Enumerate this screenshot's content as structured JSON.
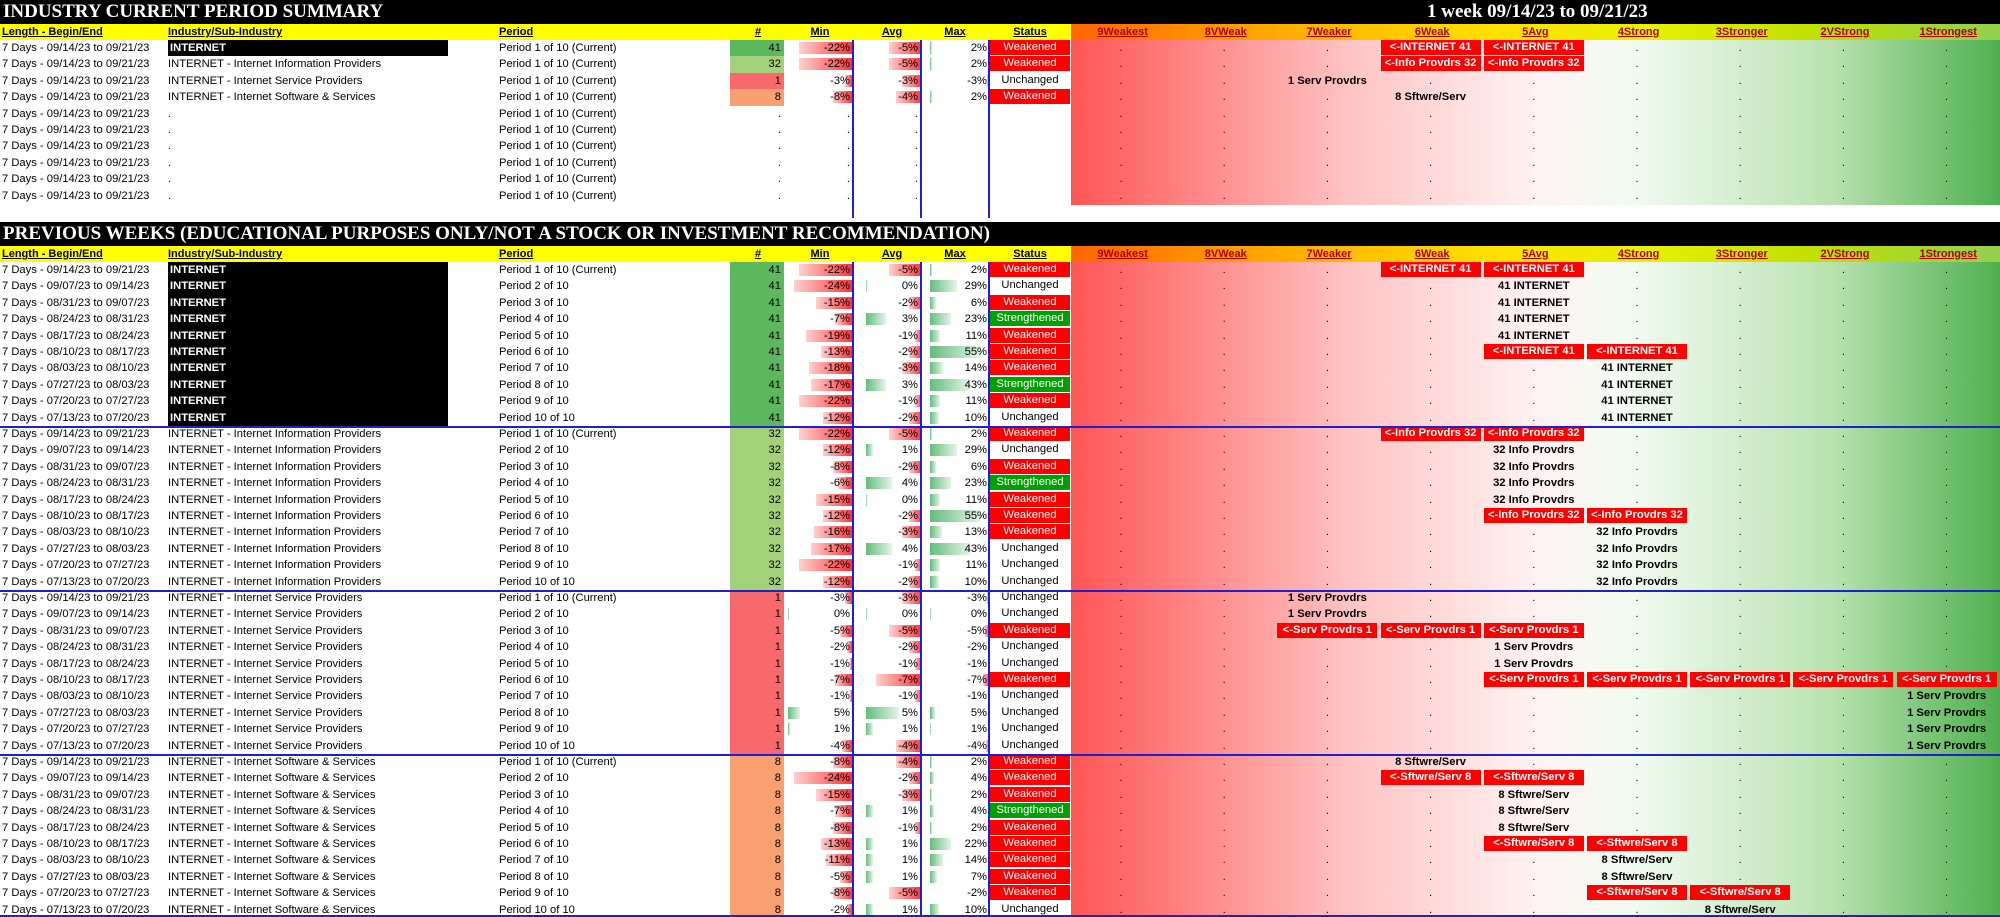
{
  "title1": "INDUSTRY CURRENT PERIOD SUMMARY",
  "title1_right": "1 week 09/14/23 to 09/21/23",
  "title2": "PREVIOUS WEEKS (EDUCATIONAL PURPOSES ONLY/NOT A STOCK OR INVESTMENT RECOMMENDATION)",
  "headers": {
    "length": "Length - Begin/End",
    "industry": "Industry/Sub-Industry",
    "period": "Period",
    "count": "#",
    "min": "Min",
    "avg": "Avg",
    "max": "Max",
    "status": "Status"
  },
  "bands": [
    "9Weakest",
    "8VWeak",
    "7Weaker",
    "6Weak",
    "5Avg",
    "4Strong",
    "3Stronger",
    "2VStrong",
    "1Strongest"
  ],
  "colors": {
    "weakened": "#ff0000",
    "strengthened": "#00a000",
    "header": "#ffff00",
    "title_bg": "#000000"
  },
  "current": [
    {
      "len": "7 Days - 09/14/23 to 09/21/23",
      "ind": "INTERNET",
      "blk": true,
      "period": "Period 1 of 10 (Current)",
      "n": "41",
      "min": "-22%",
      "avg": "-5%",
      "max": "2%",
      "mn": -22,
      "av": -5,
      "mx": 2,
      "status": "Weakened",
      "tags": {
        "3": "<-INTERNET 41",
        "4": "<-INTERNET 41"
      }
    },
    {
      "len": "7 Days - 09/14/23 to 09/21/23",
      "ind": "INTERNET - Internet Information Providers",
      "period": "Period 1 of 10 (Current)",
      "n": "32",
      "min": "-22%",
      "avg": "-5%",
      "max": "2%",
      "mn": -22,
      "av": -5,
      "mx": 2,
      "status": "Weakened",
      "tags": {
        "3": "<-Info Provdrs 32",
        "4": "<-Info Provdrs 32"
      }
    },
    {
      "len": "7 Days - 09/14/23 to 09/21/23",
      "ind": "INTERNET - Internet Service Providers",
      "period": "Period 1 of 10 (Current)",
      "n": "1",
      "min": "-3%",
      "avg": "-3%",
      "max": "-3%",
      "mn": -3,
      "av": -3,
      "mx": -3,
      "status": "Unchanged",
      "plain": {
        "2": "1 Serv Provdrs"
      }
    },
    {
      "len": "7 Days - 09/14/23 to 09/21/23",
      "ind": "INTERNET - Internet Software & Services",
      "period": "Period 1 of 10 (Current)",
      "n": "8",
      "min": "-8%",
      "avg": "-4%",
      "max": "2%",
      "mn": -8,
      "av": -4,
      "mx": 2,
      "status": "Weakened",
      "plain": {
        "3": "8 Sftwre/Serv"
      }
    },
    {
      "len": "7 Days - 09/14/23 to 09/21/23",
      "ind": ".",
      "period": "Period 1 of 10 (Current)",
      "n": ".",
      "min": ".",
      "avg": ".",
      "max": "",
      "status": ""
    },
    {
      "len": "7 Days - 09/14/23 to 09/21/23",
      "ind": ".",
      "period": "Period 1 of 10 (Current)",
      "n": ".",
      "min": ".",
      "avg": ".",
      "max": "",
      "status": ""
    },
    {
      "len": "7 Days - 09/14/23 to 09/21/23",
      "ind": ".",
      "period": "Period 1 of 10 (Current)",
      "n": ".",
      "min": ".",
      "avg": ".",
      "max": "",
      "status": ""
    },
    {
      "len": "7 Days - 09/14/23 to 09/21/23",
      "ind": ".",
      "period": "Period 1 of 10 (Current)",
      "n": ".",
      "min": ".",
      "avg": ".",
      "max": "",
      "status": ""
    },
    {
      "len": "7 Days - 09/14/23 to 09/21/23",
      "ind": ".",
      "period": "Period 1 of 10 (Current)",
      "n": ".",
      "min": ".",
      "avg": ".",
      "max": "",
      "status": ""
    },
    {
      "len": "7 Days - 09/14/23 to 09/21/23",
      "ind": ".",
      "period": "Period 1 of 10 (Current)",
      "n": ".",
      "min": ".",
      "avg": ".",
      "max": "",
      "status": ""
    }
  ],
  "previous": [
    {
      "len": "7 Days - 09/14/23 to 09/21/23",
      "ind": "INTERNET",
      "blk": true,
      "period": "Period 1 of 10 (Current)",
      "n": "41",
      "min": "-22%",
      "avg": "-5%",
      "max": "2%",
      "mn": -22,
      "av": -5,
      "mx": 2,
      "status": "Weakened",
      "tags": {
        "3": "<-INTERNET 41",
        "4": "<-INTERNET 41"
      }
    },
    {
      "len": "7 Days - 09/07/23 to 09/14/23",
      "ind": "INTERNET",
      "blk": true,
      "period": "Period 2 of 10",
      "n": "41",
      "min": "-24%",
      "avg": "0%",
      "max": "29%",
      "mn": -24,
      "av": 0,
      "mx": 29,
      "status": "Unchanged",
      "plain": {
        "4": "41 INTERNET"
      }
    },
    {
      "len": "7 Days - 08/31/23 to 09/07/23",
      "ind": "INTERNET",
      "blk": true,
      "period": "Period 3 of 10",
      "n": "41",
      "min": "-15%",
      "avg": "-2%",
      "max": "6%",
      "mn": -15,
      "av": -2,
      "mx": 6,
      "status": "Weakened",
      "plain": {
        "4": "41 INTERNET"
      }
    },
    {
      "len": "7 Days - 08/24/23 to 08/31/23",
      "ind": "INTERNET",
      "blk": true,
      "period": "Period 4 of 10",
      "n": "41",
      "min": "-7%",
      "avg": "3%",
      "max": "23%",
      "mn": -7,
      "av": 3,
      "mx": 23,
      "status": "Strengthened",
      "plain": {
        "4": "41 INTERNET"
      }
    },
    {
      "len": "7 Days - 08/17/23 to 08/24/23",
      "ind": "INTERNET",
      "blk": true,
      "period": "Period 5 of 10",
      "n": "41",
      "min": "-19%",
      "avg": "-1%",
      "max": "11%",
      "mn": -19,
      "av": -1,
      "mx": 11,
      "status": "Weakened",
      "plain": {
        "4": "41 INTERNET"
      }
    },
    {
      "len": "7 Days - 08/10/23 to 08/17/23",
      "ind": "INTERNET",
      "blk": true,
      "period": "Period 6 of 10",
      "n": "41",
      "min": "-13%",
      "avg": "-2%",
      "max": "55%",
      "mn": -13,
      "av": -2,
      "mx": 55,
      "status": "Weakened",
      "tags": {
        "4": "<-INTERNET 41",
        "5": "<-INTERNET 41"
      }
    },
    {
      "len": "7 Days - 08/03/23 to 08/10/23",
      "ind": "INTERNET",
      "blk": true,
      "period": "Period 7 of 10",
      "n": "41",
      "min": "-18%",
      "avg": "-3%",
      "max": "14%",
      "mn": -18,
      "av": -3,
      "mx": 14,
      "status": "Weakened",
      "plain": {
        "5": "41 INTERNET"
      }
    },
    {
      "len": "7 Days - 07/27/23 to 08/03/23",
      "ind": "INTERNET",
      "blk": true,
      "period": "Period 8 of 10",
      "n": "41",
      "min": "-17%",
      "avg": "3%",
      "max": "43%",
      "mn": -17,
      "av": 3,
      "mx": 43,
      "status": "Strengthened",
      "plain": {
        "5": "41 INTERNET"
      }
    },
    {
      "len": "7 Days - 07/20/23 to 07/27/23",
      "ind": "INTERNET",
      "blk": true,
      "period": "Period 9 of 10",
      "n": "41",
      "min": "-22%",
      "avg": "-1%",
      "max": "11%",
      "mn": -22,
      "av": -1,
      "mx": 11,
      "status": "Weakened",
      "plain": {
        "5": "41 INTERNET"
      }
    },
    {
      "len": "7 Days - 07/13/23 to 07/20/23",
      "ind": "INTERNET",
      "blk": true,
      "period": "Period 10 of 10",
      "n": "41",
      "min": "-12%",
      "avg": "-2%",
      "max": "10%",
      "mn": -12,
      "av": -2,
      "mx": 10,
      "status": "Unchanged",
      "plain": {
        "5": "41 INTERNET"
      }
    },
    {
      "len": "7 Days - 09/14/23 to 09/21/23",
      "ind": "INTERNET - Internet Information Providers",
      "period": "Period 1 of 10 (Current)",
      "n": "32",
      "min": "-22%",
      "avg": "-5%",
      "max": "2%",
      "mn": -22,
      "av": -5,
      "mx": 2,
      "status": "Weakened",
      "tags": {
        "3": "<-Info Provdrs 32",
        "4": "<-Info Provdrs 32"
      }
    },
    {
      "len": "7 Days - 09/07/23 to 09/14/23",
      "ind": "INTERNET - Internet Information Providers",
      "period": "Period 2 of 10",
      "n": "32",
      "min": "-12%",
      "avg": "1%",
      "max": "29%",
      "mn": -12,
      "av": 1,
      "mx": 29,
      "status": "Unchanged",
      "plain": {
        "4": "32 Info Provdrs"
      }
    },
    {
      "len": "7 Days - 08/31/23 to 09/07/23",
      "ind": "INTERNET - Internet Information Providers",
      "period": "Period 3 of 10",
      "n": "32",
      "min": "-8%",
      "avg": "-2%",
      "max": "6%",
      "mn": -8,
      "av": -2,
      "mx": 6,
      "status": "Weakened",
      "plain": {
        "4": "32 Info Provdrs"
      }
    },
    {
      "len": "7 Days - 08/24/23 to 08/31/23",
      "ind": "INTERNET - Internet Information Providers",
      "period": "Period 4 of 10",
      "n": "32",
      "min": "-6%",
      "avg": "4%",
      "max": "23%",
      "mn": -6,
      "av": 4,
      "mx": 23,
      "status": "Strengthened",
      "plain": {
        "4": "32 Info Provdrs"
      }
    },
    {
      "len": "7 Days - 08/17/23 to 08/24/23",
      "ind": "INTERNET - Internet Information Providers",
      "period": "Period 5 of 10",
      "n": "32",
      "min": "-15%",
      "avg": "0%",
      "max": "11%",
      "mn": -15,
      "av": 0,
      "mx": 11,
      "status": "Weakened",
      "plain": {
        "4": "32 Info Provdrs"
      }
    },
    {
      "len": "7 Days - 08/10/23 to 08/17/23",
      "ind": "INTERNET - Internet Information Providers",
      "period": "Period 6 of 10",
      "n": "32",
      "min": "-12%",
      "avg": "-2%",
      "max": "55%",
      "mn": -12,
      "av": -2,
      "mx": 55,
      "status": "Weakened",
      "tags": {
        "4": "<-Info Provdrs 32",
        "5": "<-Info Provdrs 32"
      }
    },
    {
      "len": "7 Days - 08/03/23 to 08/10/23",
      "ind": "INTERNET - Internet Information Providers",
      "period": "Period 7 of 10",
      "n": "32",
      "min": "-16%",
      "avg": "-3%",
      "max": "13%",
      "mn": -16,
      "av": -3,
      "mx": 13,
      "status": "Weakened",
      "plain": {
        "5": "32 Info Provdrs"
      }
    },
    {
      "len": "7 Days - 07/27/23 to 08/03/23",
      "ind": "INTERNET - Internet Information Providers",
      "period": "Period 8 of 10",
      "n": "32",
      "min": "-17%",
      "avg": "4%",
      "max": "43%",
      "mn": -17,
      "av": 4,
      "mx": 43,
      "status": "Unchanged",
      "plain": {
        "5": "32 Info Provdrs"
      }
    },
    {
      "len": "7 Days - 07/20/23 to 07/27/23",
      "ind": "INTERNET - Internet Information Providers",
      "period": "Period 9 of 10",
      "n": "32",
      "min": "-22%",
      "avg": "-1%",
      "max": "11%",
      "mn": -22,
      "av": -1,
      "mx": 11,
      "status": "Unchanged",
      "plain": {
        "5": "32 Info Provdrs"
      }
    },
    {
      "len": "7 Days - 07/13/23 to 07/20/23",
      "ind": "INTERNET - Internet Information Providers",
      "period": "Period 10 of 10",
      "n": "32",
      "min": "-12%",
      "avg": "-2%",
      "max": "10%",
      "mn": -12,
      "av": -2,
      "mx": 10,
      "status": "Unchanged",
      "plain": {
        "5": "32 Info Provdrs"
      }
    },
    {
      "len": "7 Days - 09/14/23 to 09/21/23",
      "ind": "INTERNET - Internet Service Providers",
      "period": "Period 1 of 10 (Current)",
      "n": "1",
      "min": "-3%",
      "avg": "-3%",
      "max": "-3%",
      "mn": -3,
      "av": -3,
      "mx": -3,
      "status": "Unchanged",
      "plain": {
        "2": "1 Serv Provdrs"
      }
    },
    {
      "len": "7 Days - 09/07/23 to 09/14/23",
      "ind": "INTERNET - Internet Service Providers",
      "period": "Period 2 of 10",
      "n": "1",
      "min": "0%",
      "avg": "0%",
      "max": "0%",
      "mn": 0,
      "av": 0,
      "mx": 0,
      "status": "Unchanged",
      "plain": {
        "2": "1 Serv Provdrs"
      }
    },
    {
      "len": "7 Days - 08/31/23 to 09/07/23",
      "ind": "INTERNET - Internet Service Providers",
      "period": "Period 3 of 10",
      "n": "1",
      "min": "-5%",
      "avg": "-5%",
      "max": "-5%",
      "mn": -5,
      "av": -5,
      "mx": -5,
      "status": "Weakened",
      "tags": {
        "2": "<-Serv Provdrs 1",
        "3": "<-Serv Provdrs 1",
        "4": "<-Serv Provdrs 1"
      }
    },
    {
      "len": "7 Days - 08/24/23 to 08/31/23",
      "ind": "INTERNET - Internet Service Providers",
      "period": "Period 4 of 10",
      "n": "1",
      "min": "-2%",
      "avg": "-2%",
      "max": "-2%",
      "mn": -2,
      "av": -2,
      "mx": -2,
      "status": "Unchanged",
      "plain": {
        "4": "1 Serv Provdrs"
      }
    },
    {
      "len": "7 Days - 08/17/23 to 08/24/23",
      "ind": "INTERNET - Internet Service Providers",
      "period": "Period 5 of 10",
      "n": "1",
      "min": "-1%",
      "avg": "-1%",
      "max": "-1%",
      "mn": -1,
      "av": -1,
      "mx": -1,
      "status": "Unchanged",
      "plain": {
        "4": "1 Serv Provdrs"
      }
    },
    {
      "len": "7 Days - 08/10/23 to 08/17/23",
      "ind": "INTERNET - Internet Service Providers",
      "period": "Period 6 of 10",
      "n": "1",
      "min": "-7%",
      "avg": "-7%",
      "max": "-7%",
      "mn": -7,
      "av": -7,
      "mx": -7,
      "status": "Weakened",
      "tags": {
        "4": "<-Serv Provdrs 1",
        "5": "<-Serv Provdrs 1",
        "6": "<-Serv Provdrs 1",
        "7": "<-Serv Provdrs 1",
        "8": "<-Serv Provdrs 1"
      }
    },
    {
      "len": "7 Days - 08/03/23 to 08/10/23",
      "ind": "INTERNET - Internet Service Providers",
      "period": "Period 7 of 10",
      "n": "1",
      "min": "-1%",
      "avg": "-1%",
      "max": "-1%",
      "mn": -1,
      "av": -1,
      "mx": -1,
      "status": "Unchanged",
      "plain": {
        "8": "1 Serv Provdrs"
      }
    },
    {
      "len": "7 Days - 07/27/23 to 08/03/23",
      "ind": "INTERNET - Internet Service Providers",
      "period": "Period 8 of 10",
      "n": "1",
      "min": "5%",
      "avg": "5%",
      "max": "5%",
      "mn": 5,
      "av": 5,
      "mx": 5,
      "status": "Unchanged",
      "plain": {
        "8": "1 Serv Provdrs"
      }
    },
    {
      "len": "7 Days - 07/20/23 to 07/27/23",
      "ind": "INTERNET - Internet Service Providers",
      "period": "Period 9 of 10",
      "n": "1",
      "min": "1%",
      "avg": "1%",
      "max": "1%",
      "mn": 1,
      "av": 1,
      "mx": 1,
      "status": "Unchanged",
      "plain": {
        "8": "1 Serv Provdrs"
      }
    },
    {
      "len": "7 Days - 07/13/23 to 07/20/23",
      "ind": "INTERNET - Internet Service Providers",
      "period": "Period 10 of 10",
      "n": "1",
      "min": "-4%",
      "avg": "-4%",
      "max": "-4%",
      "mn": -4,
      "av": -4,
      "mx": -4,
      "status": "Unchanged",
      "plain": {
        "8": "1 Serv Provdrs"
      }
    },
    {
      "len": "7 Days - 09/14/23 to 09/21/23",
      "ind": "INTERNET - Internet Software & Services",
      "period": "Period 1 of 10 (Current)",
      "n": "8",
      "min": "-8%",
      "avg": "-4%",
      "max": "2%",
      "mn": -8,
      "av": -4,
      "mx": 2,
      "status": "Weakened",
      "plain": {
        "3": "8 Sftwre/Serv"
      }
    },
    {
      "len": "7 Days - 09/07/23 to 09/14/23",
      "ind": "INTERNET - Internet Software & Services",
      "period": "Period 2 of 10",
      "n": "8",
      "min": "-24%",
      "avg": "-2%",
      "max": "4%",
      "mn": -24,
      "av": -2,
      "mx": 4,
      "status": "Weakened",
      "tags": {
        "3": "<-Sftwre/Serv 8",
        "4": "<-Sftwre/Serv 8"
      }
    },
    {
      "len": "7 Days - 08/31/23 to 09/07/23",
      "ind": "INTERNET - Internet Software & Services",
      "period": "Period 3 of 10",
      "n": "8",
      "min": "-15%",
      "avg": "-3%",
      "max": "2%",
      "mn": -15,
      "av": -3,
      "mx": 2,
      "status": "Weakened",
      "plain": {
        "4": "8 Sftwre/Serv"
      }
    },
    {
      "len": "7 Days - 08/24/23 to 08/31/23",
      "ind": "INTERNET - Internet Software & Services",
      "period": "Period 4 of 10",
      "n": "8",
      "min": "-7%",
      "avg": "1%",
      "max": "4%",
      "mn": -7,
      "av": 1,
      "mx": 4,
      "status": "Strengthened",
      "plain": {
        "4": "8 Sftwre/Serv"
      }
    },
    {
      "len": "7 Days - 08/17/23 to 08/24/23",
      "ind": "INTERNET - Internet Software & Services",
      "period": "Period 5 of 10",
      "n": "8",
      "min": "-8%",
      "avg": "-1%",
      "max": "2%",
      "mn": -8,
      "av": -1,
      "mx": 2,
      "status": "Weakened",
      "plain": {
        "4": "8 Sftwre/Serv"
      }
    },
    {
      "len": "7 Days - 08/10/23 to 08/17/23",
      "ind": "INTERNET - Internet Software & Services",
      "period": "Period 6 of 10",
      "n": "8",
      "min": "-13%",
      "avg": "1%",
      "max": "22%",
      "mn": -13,
      "av": 1,
      "mx": 22,
      "status": "Weakened",
      "tags": {
        "4": "<-Sftwre/Serv 8",
        "5": "<-Sftwre/Serv 8"
      }
    },
    {
      "len": "7 Days - 08/03/23 to 08/10/23",
      "ind": "INTERNET - Internet Software & Services",
      "period": "Period 7 of 10",
      "n": "8",
      "min": "-11%",
      "avg": "1%",
      "max": "14%",
      "mn": -11,
      "av": 1,
      "mx": 14,
      "status": "Weakened",
      "plain": {
        "5": "8 Sftwre/Serv"
      }
    },
    {
      "len": "7 Days - 07/27/23 to 08/03/23",
      "ind": "INTERNET - Internet Software & Services",
      "period": "Period 8 of 10",
      "n": "8",
      "min": "-5%",
      "avg": "1%",
      "max": "7%",
      "mn": -5,
      "av": 1,
      "mx": 7,
      "status": "Weakened",
      "plain": {
        "5": "8 Sftwre/Serv"
      }
    },
    {
      "len": "7 Days - 07/20/23 to 07/27/23",
      "ind": "INTERNET - Internet Software & Services",
      "period": "Period 9 of 10",
      "n": "8",
      "min": "-8%",
      "avg": "-5%",
      "max": "-2%",
      "mn": -8,
      "av": -5,
      "mx": -2,
      "status": "Weakened",
      "tags": {
        "5": "<-Sftwre/Serv 8",
        "6": "<-Sftwre/Serv 8"
      }
    },
    {
      "len": "7 Days - 07/13/23 to 07/20/23",
      "ind": "INTERNET - Internet Software & Services",
      "period": "Period 10 of 10",
      "n": "8",
      "min": "-2%",
      "avg": "1%",
      "max": "10%",
      "mn": -2,
      "av": 1,
      "mx": 10,
      "status": "Unchanged",
      "plain": {
        "6": "8 Sftwre/Serv"
      }
    }
  ]
}
